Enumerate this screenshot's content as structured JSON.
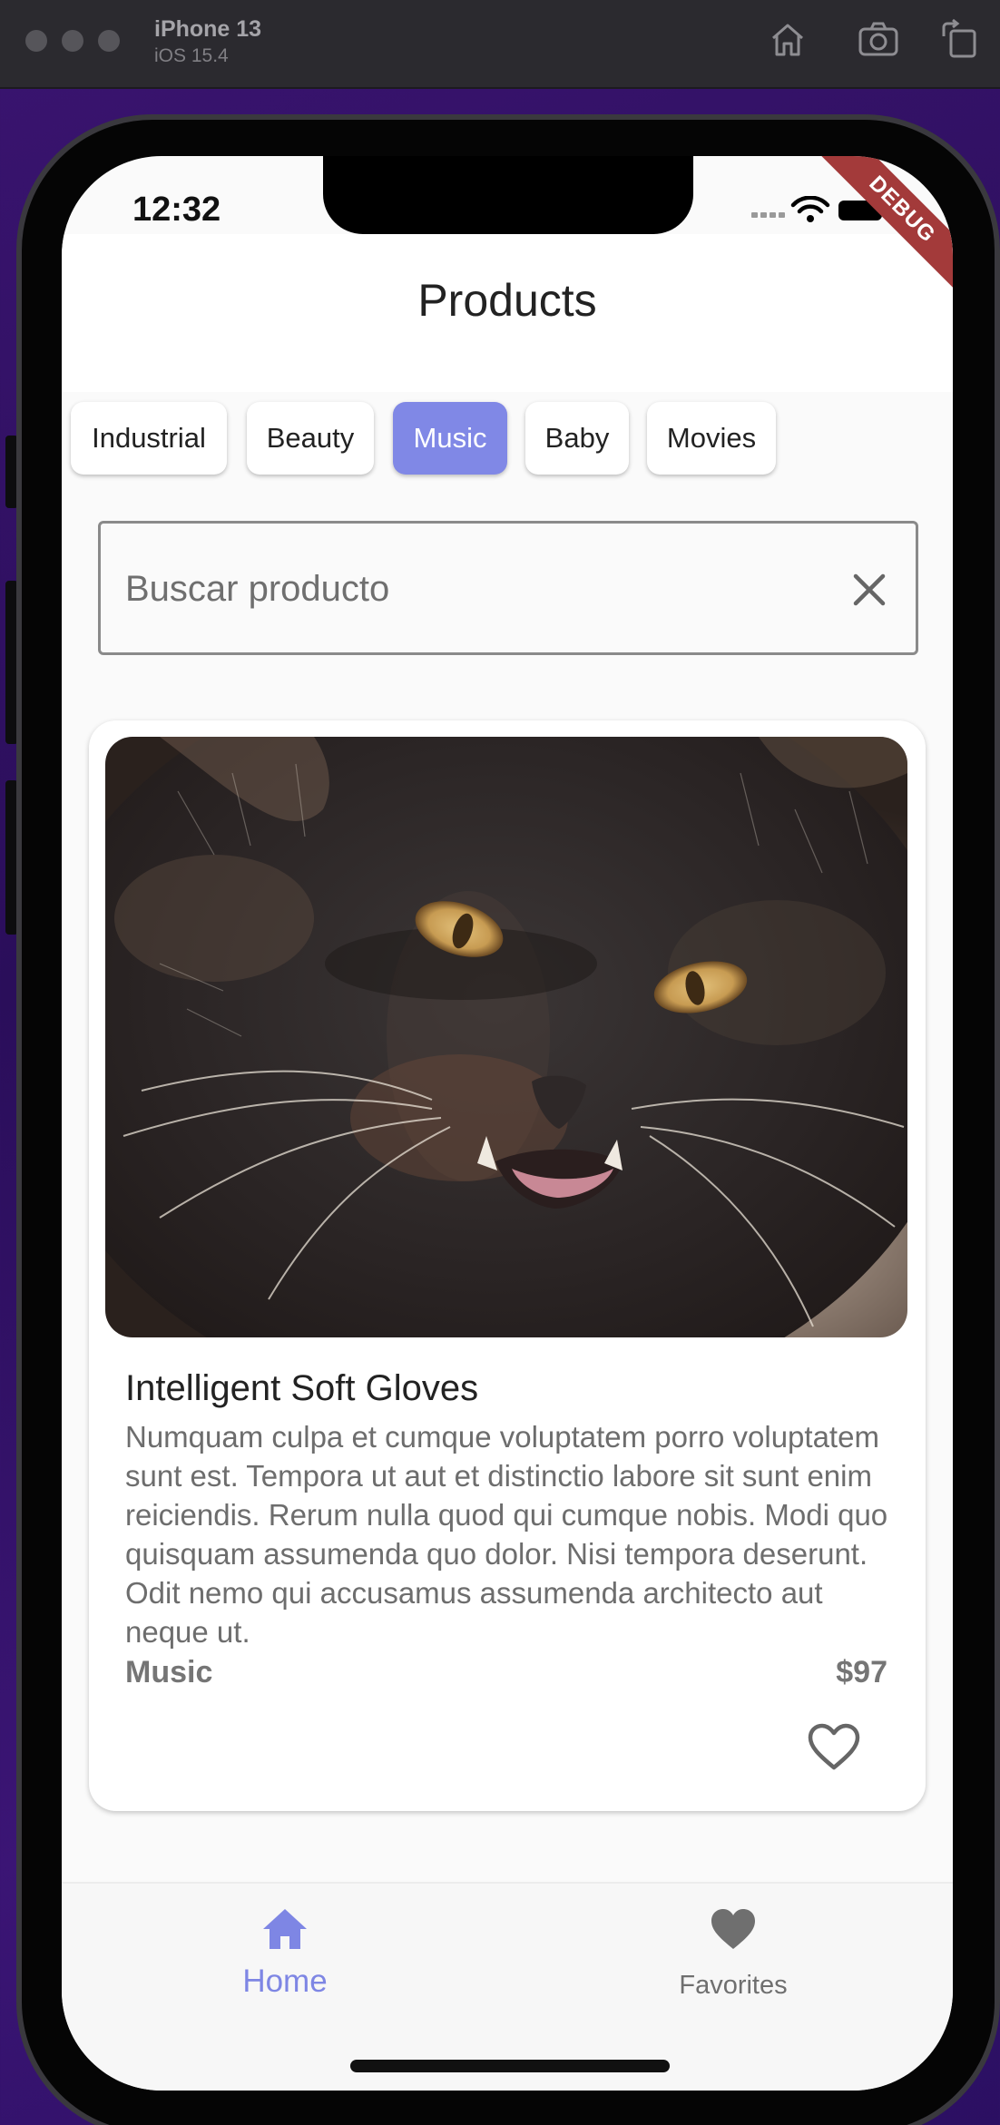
{
  "simulator": {
    "device_name": "iPhone 13",
    "os_version": "iOS 15.4",
    "toolbar_icons": [
      "home-icon",
      "screenshot-icon",
      "rotate-icon"
    ]
  },
  "status_bar": {
    "time": "12:32",
    "debug_banner": "DEBUG"
  },
  "app_bar": {
    "title": "Products"
  },
  "categories": {
    "items": [
      "Industrial",
      "Beauty",
      "Music",
      "Baby",
      "Movies"
    ],
    "selected": "Music",
    "selected_color": "#8088e6"
  },
  "search": {
    "placeholder": "Buscar producto",
    "value": "",
    "clear_icon": "close-icon"
  },
  "product": {
    "image": "black-cat-photo",
    "name": "Intelligent Soft Gloves",
    "description": "Numquam culpa et cumque voluptatem porro voluptatem sunt est. Tempora ut aut et distinctio labore sit sunt enim reiciendis. Rerum nulla quod qui cumque nobis. Modi quo quisquam assumenda quo dolor. Nisi tempora deserunt. Odit nemo qui accusamus assumenda architecto aut neque ut.",
    "category": "Music",
    "price": "$97",
    "favorite": false
  },
  "bottom_nav": {
    "items": [
      {
        "label": "Home",
        "icon": "home-icon",
        "active": true
      },
      {
        "label": "Favorites",
        "icon": "heart-icon",
        "active": false
      }
    ],
    "active_color": "#7e86e4"
  }
}
